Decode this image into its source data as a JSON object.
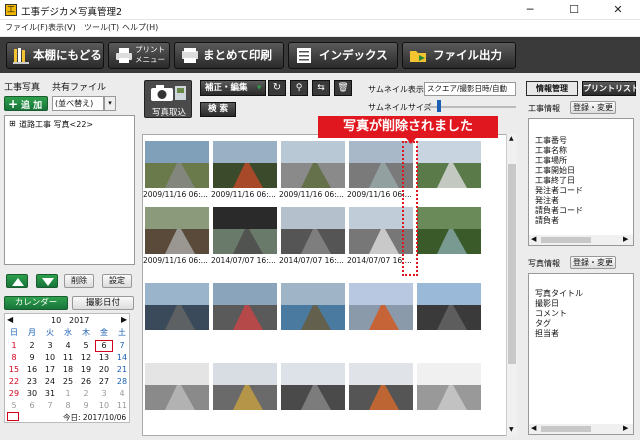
{
  "window": {
    "title": "工事デジカメ写真管理2",
    "minimize": "─",
    "maximize": "☐",
    "close": "✕",
    "app_icon": "工"
  },
  "menu": [
    "ファイル(F)",
    "表示(V)",
    "ツール(T)",
    "ヘルプ(H)"
  ],
  "toolbar": {
    "back": "本棚にもどる",
    "print_menu_line1": "プリント",
    "print_menu_line2": "メニュー",
    "batch_print": "まとめて印刷",
    "index": "インデックス",
    "file_output": "ファイル出力"
  },
  "left": {
    "tab_photos": "工事写真",
    "tab_shared": "共有ファイル",
    "add_label": "追 加",
    "sort_select": "(並べ替え)",
    "tree_item": "道路工事 写真<22>",
    "delete": "削除",
    "settings": "設定",
    "calendar_tab": "カレンダー",
    "shoot_date_tab": "撮影日付",
    "calendar": {
      "month": "10",
      "year": "2017",
      "weekdays": [
        "日",
        "月",
        "火",
        "水",
        "木",
        "金",
        "土"
      ],
      "weeks": [
        [
          "1",
          "2",
          "3",
          "4",
          "5",
          "6",
          "7"
        ],
        [
          "8",
          "9",
          "10",
          "11",
          "12",
          "13",
          "14"
        ],
        [
          "15",
          "16",
          "17",
          "18",
          "19",
          "20",
          "21"
        ],
        [
          "22",
          "23",
          "24",
          "25",
          "26",
          "27",
          "28"
        ],
        [
          "29",
          "30",
          "31",
          "1",
          "2",
          "3",
          "4"
        ],
        [
          "5",
          "6",
          "7",
          "8",
          "9",
          "10",
          "11"
        ]
      ],
      "today_label": "今日: 2017/10/06"
    }
  },
  "center": {
    "photo_import_label": "写真取込",
    "edit_menu": "補正・編集",
    "search": "検 索",
    "thumb_display_label": "サムネイル表示",
    "thumb_display_value": "スクエア/撮影日時/自動",
    "thumb_size_label": "サムネイルサイズ",
    "captions": [
      "2009/11/16 06:...",
      "2009/11/16 06:...",
      "2009/11/16 06:...",
      "2009/11/16 06:...",
      "",
      "2009/11/16 06:...",
      "2014/07/07 16:...",
      "2014/07/07 16:...",
      "2014/07/07 16:...",
      ""
    ]
  },
  "callout": "写真が削除されました",
  "right": {
    "tab_info": "情報管理",
    "tab_print": "プリントリスト",
    "work_info_label": "工事情報",
    "register_change": "登録・変更",
    "work_fields": [
      "工事番号",
      "工事名称",
      "工事場所",
      "工事開始日",
      "工事終了日",
      "発注者コード",
      "発注者",
      "請負者コード",
      "請負者"
    ],
    "photo_info_label": "写真情報",
    "photo_fields": [
      "写真タイトル",
      "撮影日",
      "コメント",
      "タグ",
      "担当者"
    ]
  },
  "colors": {
    "accent_green": "#17743a",
    "callout_red": "#e0171f",
    "toolbar_dark": "#3a3a3a",
    "sunday_red": "#d0021b",
    "saturday_blue": "#1a5fb4",
    "today_outline": "#d0021b"
  }
}
